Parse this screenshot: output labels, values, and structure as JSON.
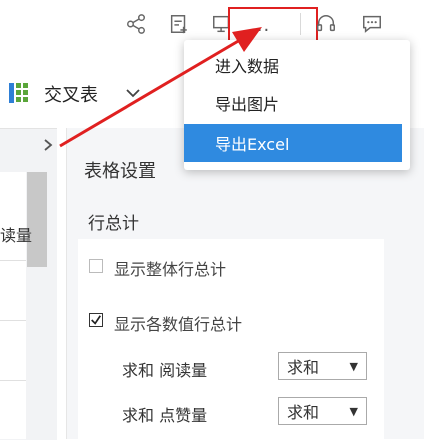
{
  "toolbar": {
    "icons": [
      "share-icon",
      "edit-icon",
      "screen-icon",
      "more-icon",
      "headset-icon",
      "comment-icon"
    ],
    "more_label": "···"
  },
  "chart": {
    "label": "交叉表"
  },
  "left_panel": {
    "cell_text": "读量"
  },
  "settings": {
    "title": "表格设置",
    "section": "行总计",
    "options": [
      {
        "label": "显示整体行总计",
        "checked": false
      },
      {
        "label": "显示各数值行总计",
        "checked": true
      }
    ],
    "rows": [
      {
        "label": "求和 阅读量",
        "select": "求和"
      },
      {
        "label": "求和 点赞量",
        "select": "求和"
      }
    ]
  },
  "dropdown": {
    "items": [
      "进入数据",
      "导出图片",
      "导出Excel"
    ],
    "selected_index": 2
  },
  "colors": {
    "highlight_red": "#e02020",
    "selected_blue": "#2f8ae0"
  }
}
